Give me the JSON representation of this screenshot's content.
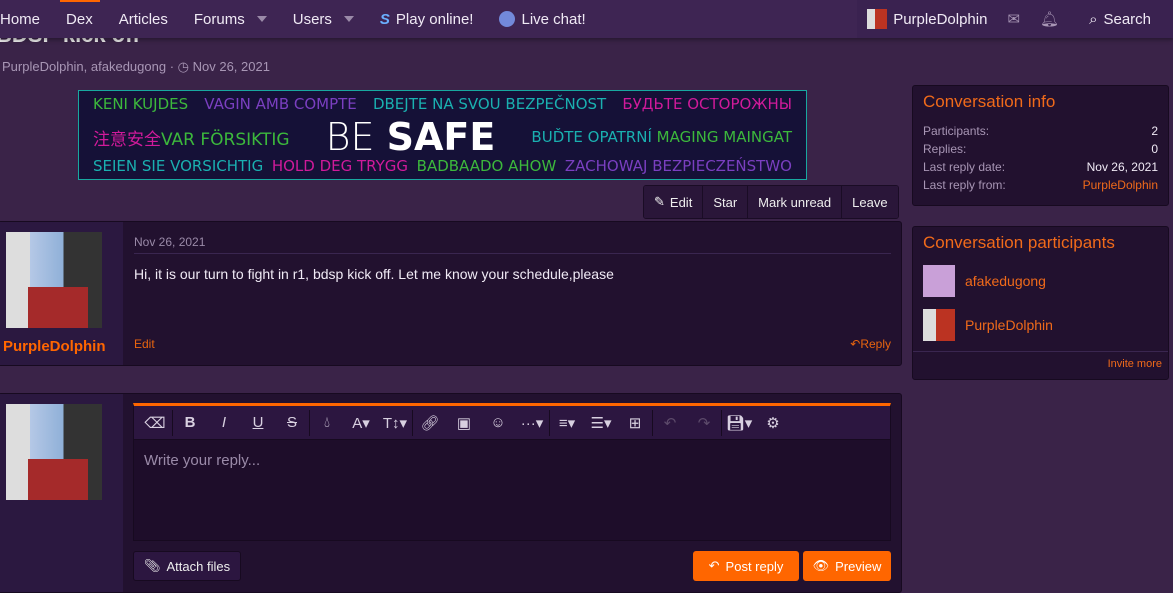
{
  "nav": {
    "items": [
      {
        "label": "Home"
      },
      {
        "label": "Dex"
      },
      {
        "label": "Articles"
      },
      {
        "label": "Forums",
        "dropdown": true
      },
      {
        "label": "Users",
        "dropdown": true
      },
      {
        "label": "Play online!",
        "icon": "showdown-icon"
      },
      {
        "label": "Live chat!",
        "icon": "discord-icon"
      }
    ],
    "user": "PurpleDolphin",
    "search": "Search"
  },
  "thread": {
    "title": "BDSP kick off",
    "participants": "PurpleDolphin, afakedugong",
    "date": "Nov 26, 2021"
  },
  "banner": {
    "row1": [
      "KENI KUJDES",
      "VAGIN AMB COMPTE",
      "DBEJTE NA SVOU BEZPEČNOST",
      "БУДЬТЕ ОСТОРОЖНЫ"
    ],
    "row2a": [
      "注意安全",
      "VAR FÖRSIKTIG"
    ],
    "be": "BE",
    "safe": "SAFE",
    "row2b": [
      "BUĎTE OPATRNÍ",
      "MAGING MAINGAT"
    ],
    "row3": [
      "SEIEN SIE VORSICHTIG",
      "HOLD DEG TRYGG",
      "BADBAADO AHOW",
      "ZACHOWAJ BEZPIECZEŃSTWO"
    ]
  },
  "actions": {
    "edit": "Edit",
    "star": "Star",
    "mark_unread": "Mark unread",
    "leave": "Leave"
  },
  "post": {
    "user": "PurpleDolphin",
    "date": "Nov 26, 2021",
    "message": "Hi, it is our turn to fight in r1, bdsp kick off. Let me know your schedule,please",
    "edit": "Edit",
    "reply": "Reply"
  },
  "editor": {
    "placeholder": "Write your reply...",
    "attach": "Attach files",
    "post_reply": "Post reply",
    "preview": "Preview"
  },
  "info": {
    "title": "Conversation info",
    "rows": [
      {
        "k": "Participants:",
        "v": "2"
      },
      {
        "k": "Replies:",
        "v": "0"
      },
      {
        "k": "Last reply date:",
        "v": "Nov 26, 2021"
      },
      {
        "k": "Last reply from:",
        "v": "PurpleDolphin"
      }
    ]
  },
  "participants": {
    "title": "Conversation participants",
    "list": [
      "afakedugong",
      "PurpleDolphin"
    ],
    "invite": "Invite more"
  },
  "colors": {
    "accent": "#ff6600",
    "background": "#3a2348",
    "panel": "#22112f"
  }
}
